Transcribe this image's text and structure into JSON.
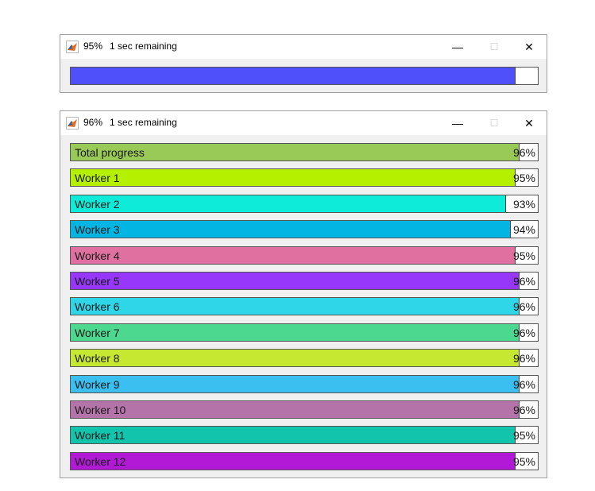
{
  "window1": {
    "title_percent": "95%",
    "title_time": "1 sec remaining",
    "bar": {
      "fraction": 0.95,
      "color": "#5050fa"
    }
  },
  "window2": {
    "title_percent": "96%",
    "title_time": "1 sec remaining",
    "bars": [
      {
        "label": "Total progress",
        "percent": "96%",
        "fraction": 0.96,
        "color": "#99c957"
      },
      {
        "label": "Worker 1",
        "percent": "95%",
        "fraction": 0.95,
        "color": "#b5f000"
      },
      {
        "label": "Worker 2",
        "percent": "93%",
        "fraction": 0.93,
        "color": "#0eebd9"
      },
      {
        "label": "Worker 3",
        "percent": "94%",
        "fraction": 0.94,
        "color": "#03b5e3"
      },
      {
        "label": "Worker 4",
        "percent": "95%",
        "fraction": 0.95,
        "color": "#e0709f"
      },
      {
        "label": "Worker 5",
        "percent": "96%",
        "fraction": 0.96,
        "color": "#9637fa"
      },
      {
        "label": "Worker 6",
        "percent": "96%",
        "fraction": 0.96,
        "color": "#2ed6e8"
      },
      {
        "label": "Worker 7",
        "percent": "96%",
        "fraction": 0.96,
        "color": "#4cd98f"
      },
      {
        "label": "Worker 8",
        "percent": "96%",
        "fraction": 0.96,
        "color": "#c6e830"
      },
      {
        "label": "Worker 9",
        "percent": "96%",
        "fraction": 0.96,
        "color": "#3bbff0"
      },
      {
        "label": "Worker 10",
        "percent": "96%",
        "fraction": 0.96,
        "color": "#b574a9"
      },
      {
        "label": "Worker 11",
        "percent": "95%",
        "fraction": 0.95,
        "color": "#13c4ac"
      },
      {
        "label": "Worker 12",
        "percent": "95%",
        "fraction": 0.95,
        "color": "#b219d6"
      }
    ]
  },
  "controls": {
    "minimize_glyph": "—",
    "maximize_glyph": "☐",
    "close_glyph": "✕"
  },
  "icons": {
    "app": "matlab-icon",
    "minimize": "minimize-icon",
    "maximize": "maximize-icon",
    "close": "close-icon"
  }
}
